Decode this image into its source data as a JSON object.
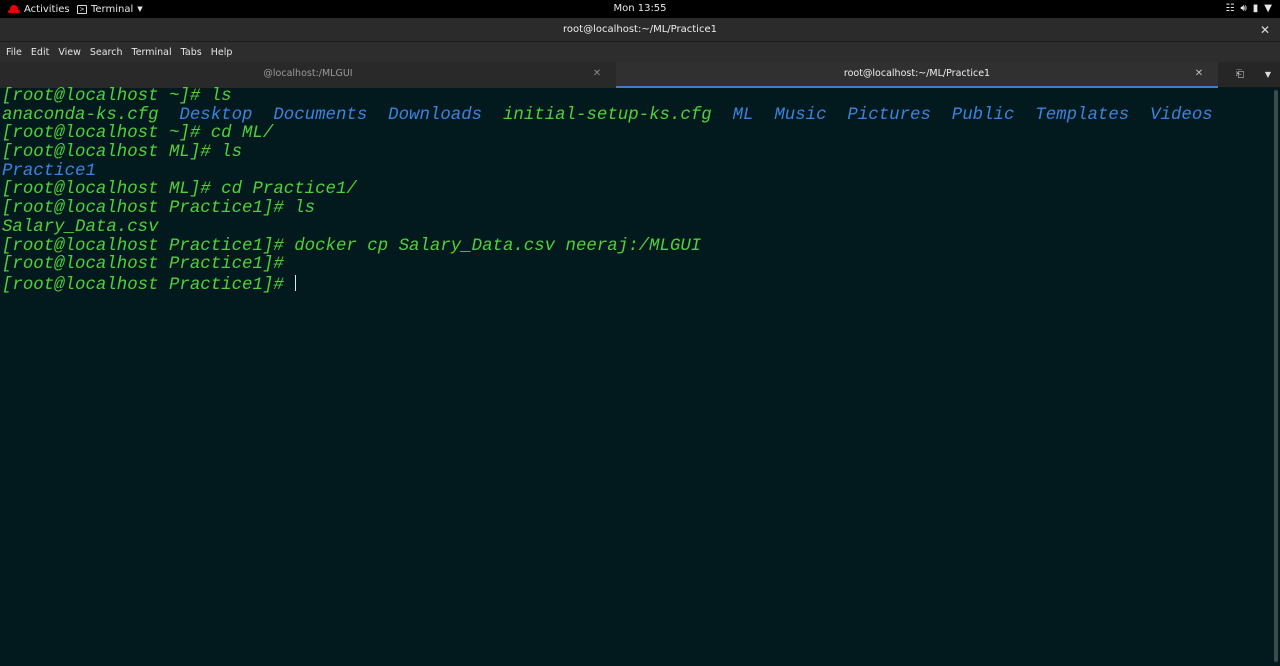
{
  "topbar": {
    "activities": "Activities",
    "app_name": "Terminal",
    "clock": "Mon 13:55"
  },
  "window": {
    "title": "root@localhost:~/ML/Practice1"
  },
  "menu": [
    "File",
    "Edit",
    "View",
    "Search",
    "Terminal",
    "Tabs",
    "Help"
  ],
  "tabs": [
    {
      "label": "@localhost:/MLGUI",
      "active": false
    },
    {
      "label": "root@localhost:~/ML/Practice1",
      "active": true
    }
  ],
  "terminal": {
    "lines": [
      {
        "prompt": "[root@localhost ~]#",
        "cmd": " ls"
      },
      {
        "ls": [
          "anaconda-ks.cfg",
          "Desktop",
          "Documents",
          "Downloads",
          "initial-setup-ks.cfg",
          "ML",
          "Music",
          "Pictures",
          "Public",
          "Templates",
          "Videos"
        ]
      },
      {
        "prompt": "[root@localhost ~]#",
        "cmd": " cd ML/"
      },
      {
        "prompt": "[root@localhost ML]#",
        "cmd": " ls"
      },
      {
        "out_dir": "Practice1"
      },
      {
        "prompt": "[root@localhost ML]#",
        "cmd": " cd Practice1/"
      },
      {
        "prompt": "[root@localhost Practice1]#",
        "cmd": " ls"
      },
      {
        "out_file": "Salary_Data.csv"
      },
      {
        "prompt": "[root@localhost Practice1]#",
        "cmd": " docker cp Salary_Data.csv neeraj:/MLGUI"
      },
      {
        "prompt": "[root@localhost Practice1]#",
        "cmd": ""
      },
      {
        "prompt": "[root@localhost Practice1]#",
        "cmd": " "
      }
    ],
    "colors": {
      "prompt": "#4ed13a",
      "directory": "#3a83e0",
      "background": "#021a1e"
    }
  }
}
